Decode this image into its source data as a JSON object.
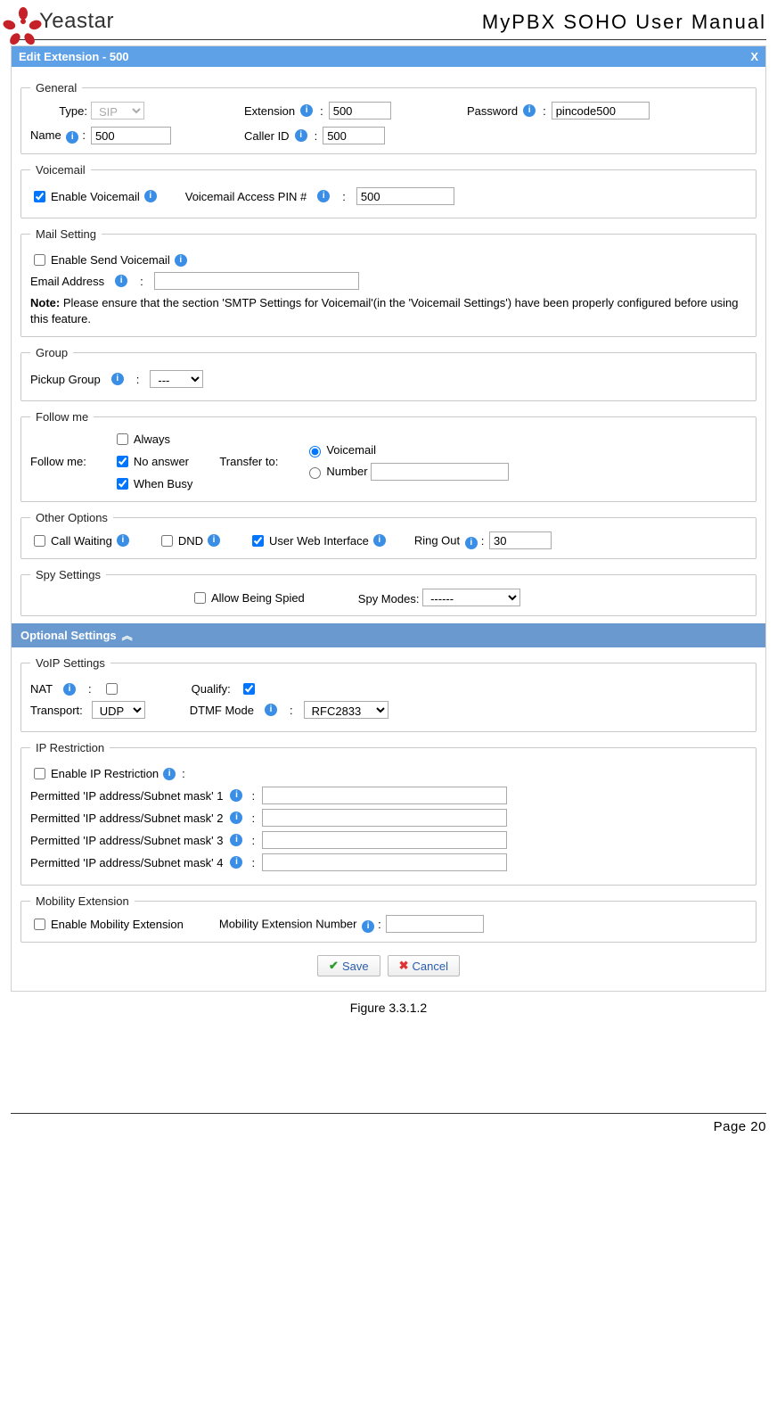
{
  "doc": {
    "logo_text": "Yeastar",
    "title": "MyPBX SOHO User Manual",
    "figure_caption": "Figure 3.3.1.2",
    "page_label": "Page 20"
  },
  "modal": {
    "title": "Edit Extension - 500",
    "close": "X",
    "optional_settings_header": "Optional Settings",
    "chevron": "«"
  },
  "general": {
    "legend": "General",
    "type_label": "Type:",
    "type_value": "SIP",
    "extension_label": "Extension",
    "extension_value": "500",
    "password_label": "Password",
    "password_value": "pincode500",
    "name_label": "Name",
    "name_value": "500",
    "callerid_label": "Caller ID",
    "callerid_value": "500"
  },
  "voicemail": {
    "legend": "Voicemail",
    "enable_label": "Enable Voicemail",
    "pin_label": "Voicemail Access PIN #",
    "pin_value": "500"
  },
  "mail": {
    "legend": "Mail Setting",
    "enable_send_label": "Enable Send Voicemail",
    "email_label": "Email Address",
    "email_value": "",
    "note_bold": "Note:",
    "note_text": " Please ensure that the section 'SMTP Settings for Voicemail'(in the 'Voicemail Settings') have been properly configured before using this feature."
  },
  "group": {
    "legend": "Group",
    "pickup_label": "Pickup Group",
    "pickup_value": "---"
  },
  "followme": {
    "legend": "Follow me",
    "label": "Follow me:",
    "always": "Always",
    "no_answer": "No answer",
    "when_busy": "When Busy",
    "transfer_label": "Transfer to:",
    "voicemail": "Voicemail",
    "number": "Number",
    "number_value": ""
  },
  "other": {
    "legend": "Other Options",
    "call_waiting": "Call Waiting",
    "dnd": "DND",
    "uwi": "User Web Interface",
    "ring_out_label": "Ring Out",
    "ring_out_value": "30"
  },
  "spy": {
    "legend": "Spy Settings",
    "allow_label": "Allow Being Spied",
    "modes_label": "Spy Modes:",
    "modes_value": "------"
  },
  "voip": {
    "legend": "VoIP Settings",
    "nat_label": "NAT",
    "qualify_label": "Qualify:",
    "transport_label": "Transport:",
    "transport_value": "UDP",
    "dtmf_label": "DTMF Mode",
    "dtmf_value": "RFC2833"
  },
  "ipr": {
    "legend": "IP Restriction",
    "enable_label": "Enable IP Restriction",
    "perm_label_prefix": "Permitted 'IP address/Subnet mask'  ",
    "n1": "1",
    "n2": "2",
    "n3": "3",
    "n4": "4",
    "v1": "",
    "v2": "",
    "v3": "",
    "v4": ""
  },
  "mobility": {
    "legend": "Mobility Extension",
    "enable_label": "Enable Mobility Extension",
    "number_label": "Mobility Extension Number",
    "number_value": ""
  },
  "buttons": {
    "save": "Save",
    "cancel": "Cancel"
  }
}
